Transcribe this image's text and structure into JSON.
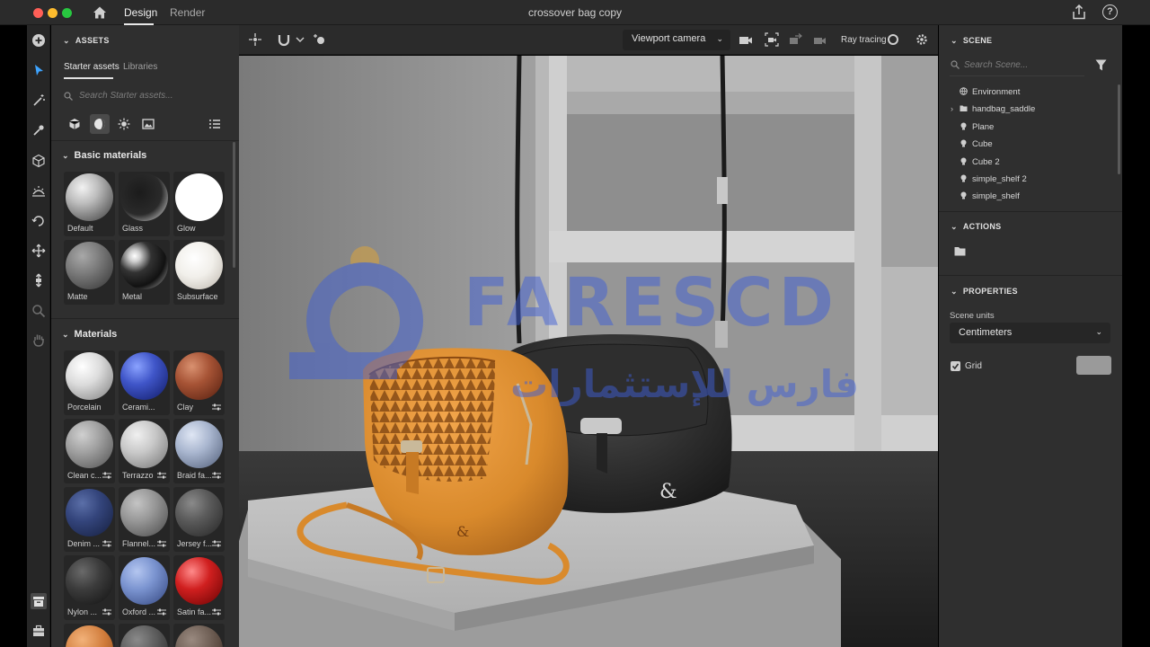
{
  "window": {
    "tabs": [
      {
        "label": "Design",
        "active": true
      },
      {
        "label": "Render",
        "active": false
      }
    ],
    "title": "crossover bag copy",
    "help_label": "?"
  },
  "assets": {
    "header": "ASSETS",
    "subtabs": [
      "Starter assets",
      "Libraries"
    ],
    "search_placeholder": "Search Starter assets...",
    "basic_title": "Basic materials",
    "basic": [
      {
        "label": "Default"
      },
      {
        "label": "Glass"
      },
      {
        "label": "Glow"
      },
      {
        "label": "Matte"
      },
      {
        "label": "Metal"
      },
      {
        "label": "Subsurface"
      }
    ],
    "materials_title": "Materials",
    "materials": [
      {
        "label": "Porcelain"
      },
      {
        "label": "Cerami..."
      },
      {
        "label": "Clay"
      },
      {
        "label": "Clean c..."
      },
      {
        "label": "Terrazzo"
      },
      {
        "label": "Braid fa..."
      },
      {
        "label": "Denim ..."
      },
      {
        "label": "Flannel..."
      },
      {
        "label": "Jersey f..."
      },
      {
        "label": "Nylon ..."
      },
      {
        "label": "Oxford ..."
      },
      {
        "label": "Satin fa..."
      }
    ]
  },
  "viewport": {
    "camera": "Viewport camera",
    "ray_tracing_label": "Ray tracing",
    "watermark_latin": "FARESCD",
    "watermark_arabic": "فارس للإستثمارات"
  },
  "scene": {
    "header": "SCENE",
    "search_placeholder": "Search Scene...",
    "items": [
      {
        "label": "Environment",
        "icon": "globe-icon"
      },
      {
        "label": "handbag_saddle",
        "icon": "folder-icon"
      },
      {
        "label": "Plane",
        "icon": "light-icon"
      },
      {
        "label": "Cube",
        "icon": "light-icon"
      },
      {
        "label": "Cube 2",
        "icon": "light-icon"
      },
      {
        "label": "simple_shelf 2",
        "icon": "light-icon"
      },
      {
        "label": "simple_shelf",
        "icon": "light-icon"
      }
    ]
  },
  "actions": {
    "header": "ACTIONS"
  },
  "properties": {
    "header": "PROPERTIES",
    "units_label": "Scene units",
    "units_value": "Centimeters",
    "grid_label": "Grid",
    "grid_checked": true,
    "grid_color": "#9a9a9a"
  }
}
